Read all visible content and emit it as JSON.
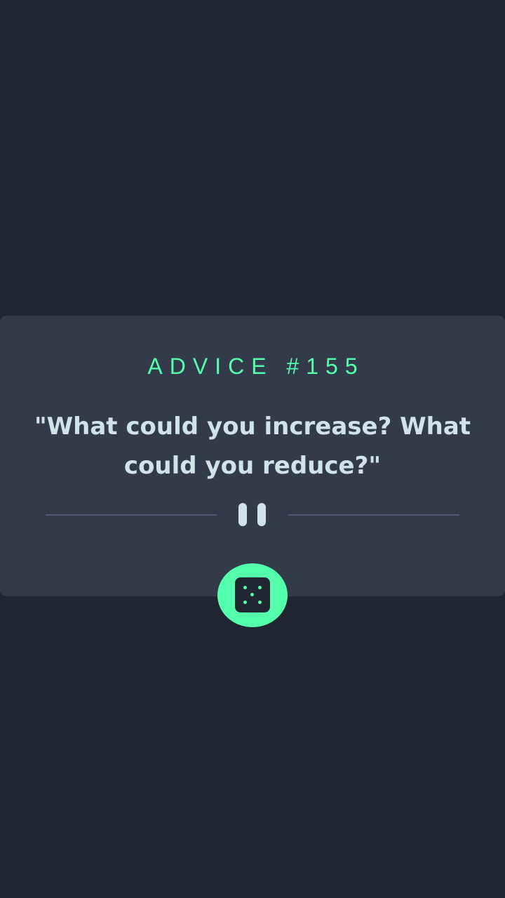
{
  "advice": {
    "heading": "ADVICE #155",
    "quote": "\"What could you increase? What could you reduce?\""
  },
  "icons": {
    "divider_symbol": "pause-icon",
    "generate_button": "dice-icon"
  },
  "colors": {
    "background": "#1f2531",
    "card": "#333a4a",
    "accent": "#53ffaa",
    "text": "#cfe3e9",
    "divider": "#4e5d73"
  }
}
